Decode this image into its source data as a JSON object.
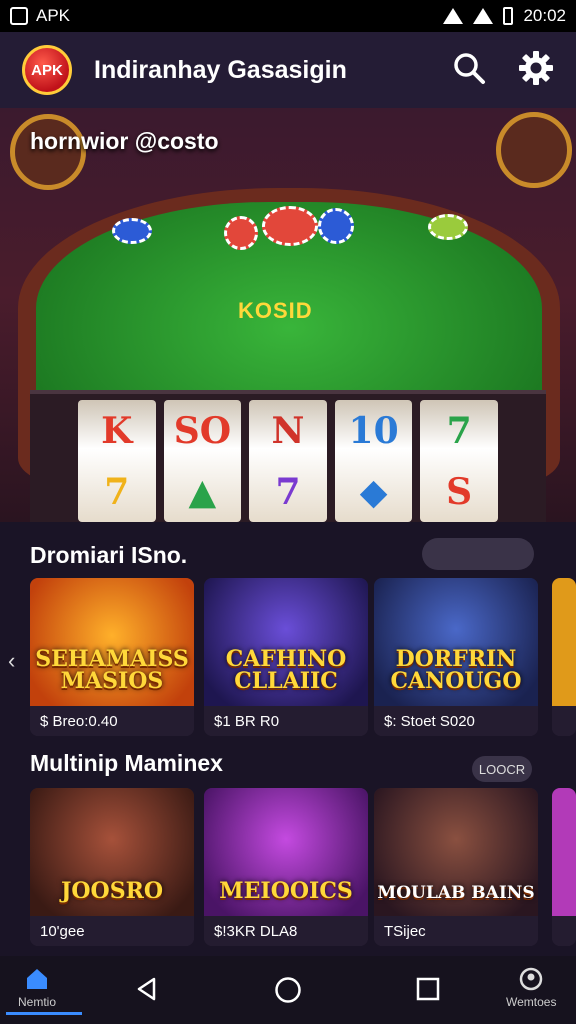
{
  "status_bar": {
    "carrier": "APK",
    "time": "20:02"
  },
  "header": {
    "logo_text": "APK",
    "title": "Indiranhay Gasasigin",
    "search_icon": "search-icon",
    "settings_icon": "gear-icon"
  },
  "hero": {
    "caption": "hornwior @costo",
    "table_text": "KOSID",
    "reels": [
      [
        "K",
        "7"
      ],
      [
        "SO",
        "▲"
      ],
      [
        "N",
        "7"
      ],
      [
        "10",
        "◆"
      ],
      [
        "7",
        "S"
      ]
    ]
  },
  "sections": [
    {
      "title": "Dromiari ISno.",
      "cards": [
        {
          "art_text": "SEHAMAISS MASIOS",
          "footer": "$ Breo:0.40",
          "bg": "#e56a12"
        },
        {
          "art_text": "CAFHINO CLLAIIC",
          "footer": "$1 BR R0",
          "bg": "#3a2a8a"
        },
        {
          "art_text": "DORFRIN CANOUGO",
          "footer": "$: Stoet S020",
          "bg": "#2d3f8a"
        }
      ]
    },
    {
      "title": "Multinip Maminex",
      "pill_label": "LOOCR",
      "cards": [
        {
          "art_text": "JOOSRO",
          "footer": "10'gee",
          "bg": "#6e2b25"
        },
        {
          "art_text": "MEIOOICS",
          "footer": "$!3KR DLA8",
          "bg": "#8a28b0"
        },
        {
          "art_text": "MOULAB BAINS",
          "footer": "TSijec",
          "bg": "#5a2f3f"
        }
      ]
    }
  ],
  "nav": {
    "home_label": "Nemtio",
    "profile_label": "Wemtoes"
  },
  "colors": {
    "accent": "#3a8cff",
    "header_bg": "#241c35",
    "felt": "#2a9a2e"
  }
}
